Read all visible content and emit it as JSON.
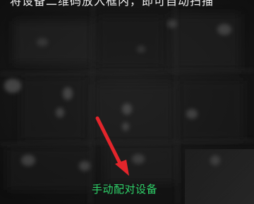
{
  "camera": {
    "top_hint": "将设备二维码放入框内，即可自动扫描"
  },
  "pairing": {
    "manual_pair_label": "手动配对设备"
  },
  "colors": {
    "background": "#171717",
    "link_green": "#2fd36a",
    "annotation_arrow": "#e3252b"
  },
  "icons": {
    "annotation": "red-arrow-icon"
  }
}
